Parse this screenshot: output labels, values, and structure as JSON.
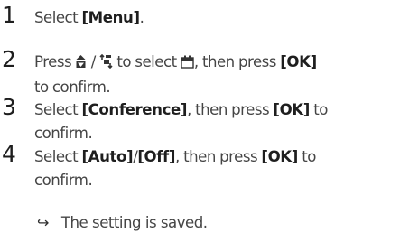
{
  "steps": [
    {
      "number": "1",
      "pre": "Select ",
      "key": "[Menu]",
      "post": "."
    },
    {
      "number": "2",
      "press": "Press",
      "slash": " / ",
      "to_select": " to select ",
      "then_press": ", then press ",
      "key": "[OK]",
      "line2": "to confirm.",
      "icons": [
        "up-down-navigation-icon",
        "channel-select-icon",
        "settings-menu-icon"
      ]
    },
    {
      "number": "3",
      "pre": "Select ",
      "key": "[Conference]",
      "mid": ", then press ",
      "key2": "[OK]",
      "post": " to",
      "line2": "confirm."
    },
    {
      "number": "4",
      "pre": "Select ",
      "key": "[Auto]",
      "sep": "/",
      "key2": "[Off]",
      "mid": ", then press ",
      "key3": "[OK]",
      "post": " to",
      "line2": "confirm."
    }
  ],
  "result": {
    "arrow": "↪",
    "text": "The setting is saved."
  }
}
